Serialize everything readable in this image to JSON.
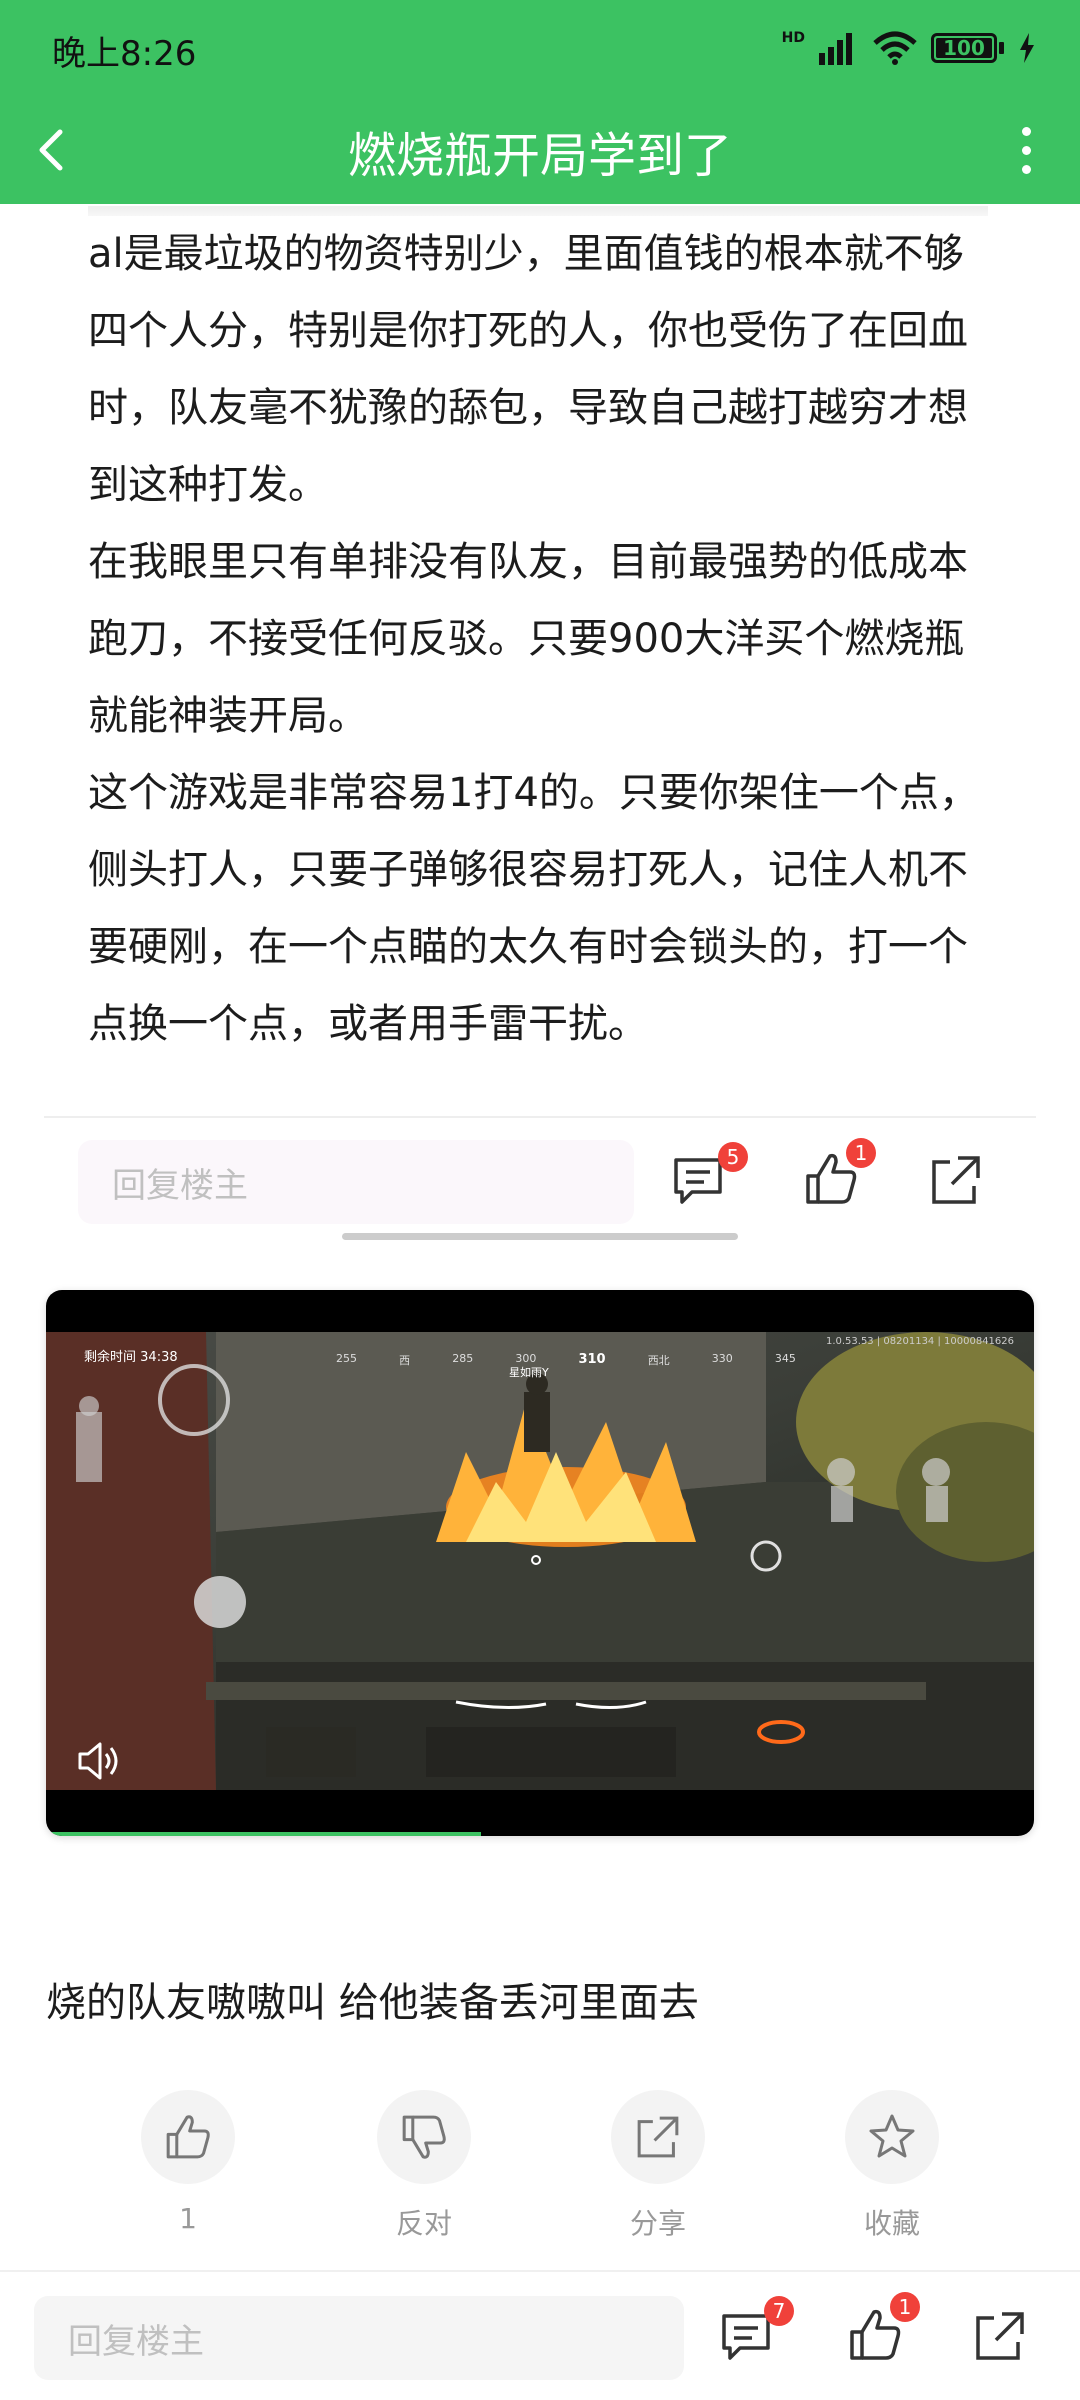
{
  "status_bar": {
    "time": "晚上8:26",
    "network": "HD",
    "battery": "100"
  },
  "header": {
    "title": "燃烧瓶开局学到了"
  },
  "post": {
    "paragraphs": [
      "al是最垃圾的物资特别少，里面值钱的根本就不够四个人分，特别是你打死的人，你也受伤了在回血时，队友毫不犹豫的舔包，导致自己越打越穷才想到这种打发。",
      "在我眼里只有单排没有队友，目前最强势的低成本跑刀，不接受任何反驳。只要900大洋买个燃烧瓶就能神装开局。",
      "这个游戏是非常容易1打4的。只要你架住一个点，侧头打人，只要子弹够很容易打死人，记住人机不要硬刚，在一个点瞄的太久有时会锁头的，打一个点换一个点，或者用手雷干扰。"
    ]
  },
  "reply_bar_inline": {
    "placeholder": "回复楼主",
    "comment_count": "5",
    "like_count": "1"
  },
  "video": {
    "progress": 0.44,
    "hud": {
      "time_label": "剩余时间",
      "time_value": "34:38",
      "compass": [
        "255",
        "西",
        "285",
        "300",
        "310",
        "西北",
        "330",
        "345"
      ],
      "heading": "310",
      "player_tag": "星如雨Y",
      "session": "1.0.53.53 | 08201134 | 10000841626"
    }
  },
  "comment": {
    "text": "烧的队友嗷嗷叫 给他装备丢河里面去"
  },
  "reactions": [
    {
      "label": "1",
      "icon": "thumbs-up-icon"
    },
    {
      "label": "反对",
      "icon": "thumbs-down-icon"
    },
    {
      "label": "分享",
      "icon": "share-icon"
    },
    {
      "label": "收藏",
      "icon": "star-icon"
    }
  ],
  "bottom_bar": {
    "placeholder": "回复楼主",
    "comment_count": "7",
    "like_count": "1"
  },
  "colors": {
    "accent": "#3cc262",
    "badge": "#f0413a"
  }
}
